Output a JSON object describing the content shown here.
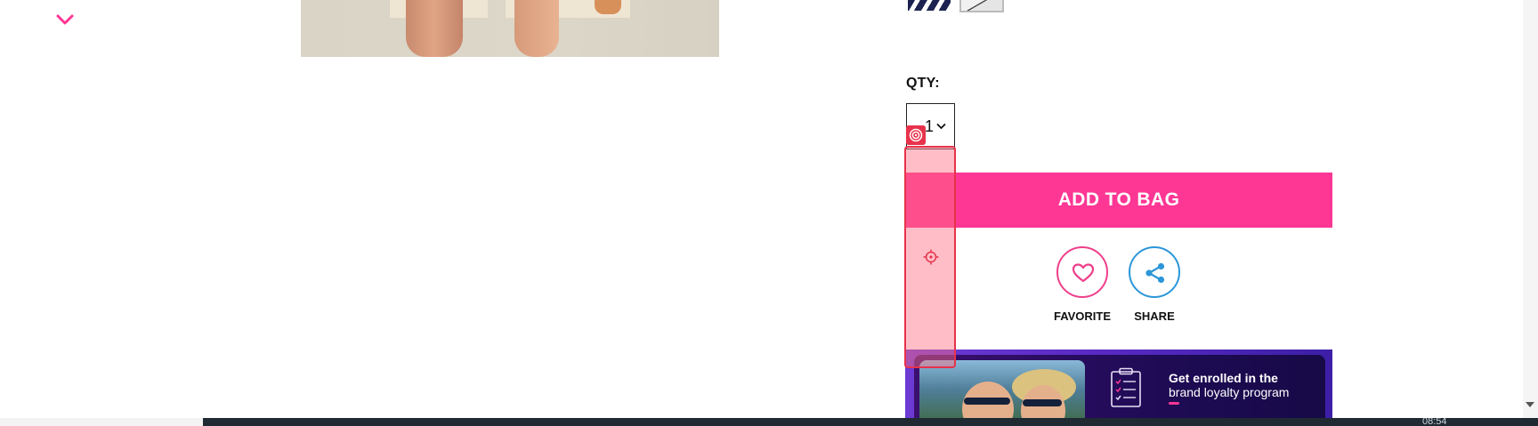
{
  "icons": {
    "thumbnail_nav": "chevron-down-icon",
    "favorite": "heart-icon",
    "share": "share-icon",
    "overlay_badge": "target-icon",
    "overlay_cursor": "crosshair-icon",
    "banner": "clipboard-checklist-icon"
  },
  "colors": {
    "accent_pink": "#fe3694",
    "share_blue": "#2c96d8",
    "overlay_red": "#e8324b",
    "banner_purple": "#5b2bc6"
  },
  "product": {
    "qty_label": "QTY:",
    "qty_value": "1",
    "add_to_bag_label": "ADD TO BAG",
    "favorite_label": "FAVORITE",
    "share_label": "SHARE"
  },
  "banner": {
    "title": "Get enrolled in the",
    "subtitle": "brand loyalty program"
  },
  "taskbar": {
    "clock": "08:54"
  }
}
